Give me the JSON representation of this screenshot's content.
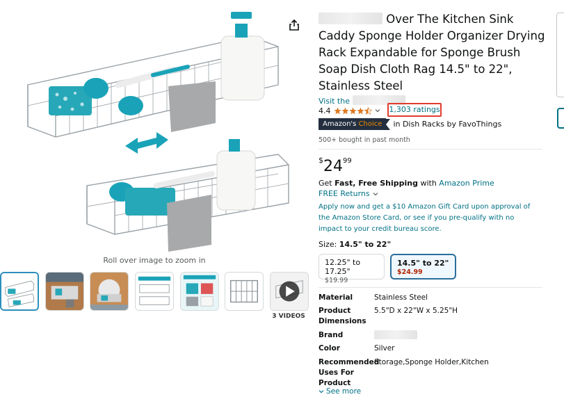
{
  "product": {
    "title_text": "Over The Kitchen Sink Caddy Sponge Holder Organizer Drying Rack Expandable for Sponge Brush Soap Dish Cloth Rag 14.5\" to 22\", Stainless Steel",
    "visit_label": "Visit the",
    "rating_value": "4.4",
    "rating_stars": 4.4,
    "ratings_count": "1,303 ratings",
    "badge_amazon": "Amazon's",
    "badge_choice": "Choice",
    "badge_category": "in Dish Racks by FavoThings",
    "bought_text": "500+ bought in past month"
  },
  "price": {
    "currency": "$",
    "whole": "24",
    "fraction": "99"
  },
  "shipping": {
    "prefix": "Get ",
    "bold": "Fast, Free Shipping",
    "middle": " with ",
    "prime": "Amazon Prime",
    "returns": "FREE Returns"
  },
  "promo_text": "Apply now and get a $10 Amazon Gift Card upon approval of the Amazon Store Card, or see if you pre-qualify with no impact to your credit bureau score.",
  "size": {
    "label": "Size:",
    "selected": "14.5\" to 22\"",
    "options": [
      {
        "name": "12.25\" to 17.25\"",
        "price": "$19.99"
      },
      {
        "name": "14.5\" to 22\"",
        "price": "$24.99"
      }
    ]
  },
  "specs": [
    {
      "key": "Material",
      "value": "Stainless Steel"
    },
    {
      "key": "Product Dimensions",
      "value": "5.5\"D x 22\"W x 5.25\"H"
    },
    {
      "key": "Brand",
      "value": ""
    },
    {
      "key": "Color",
      "value": "Silver"
    },
    {
      "key": "Recommended Uses For Product",
      "value": "Storage,Sponge Holder,Kitchen"
    }
  ],
  "see_more": "See more",
  "gallery": {
    "zoom_hint": "Roll over image to zoom in",
    "video_label": "3 VIDEOS"
  },
  "colors": {
    "link": "#007185",
    "star": "#de7921",
    "highlight_box": "#e23b2e",
    "teal_accent": "#1aa3b8"
  }
}
